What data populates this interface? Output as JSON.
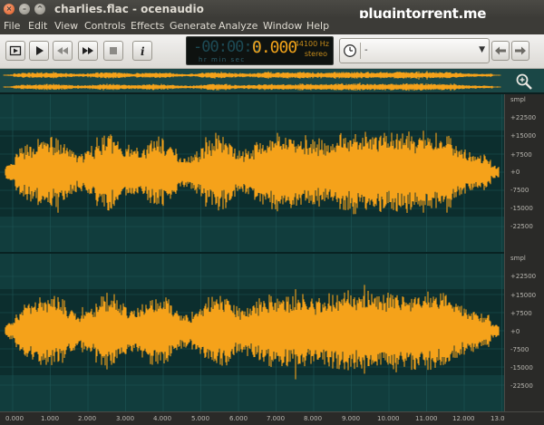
{
  "window": {
    "title": "charlies.flac - ocenaudio",
    "watermark": "plugintorrent.me"
  },
  "menu": [
    "File",
    "Edit",
    "View",
    "Controls",
    "Effects",
    "Generate",
    "Analyze",
    "Window",
    "Help"
  ],
  "display": {
    "time_dim": "-00:00:0",
    "time_value": "0.000",
    "units": "hr  min  sec",
    "sample_rate": "44100 Hz",
    "channels": "stereo"
  },
  "combo": {
    "value": "-"
  },
  "ruler": {
    "unit": "smpl",
    "ticks": [
      "+22500",
      "+15000",
      "+7500",
      "+0",
      "-7500",
      "-15000",
      "-22500"
    ]
  },
  "timeline": [
    "0.000",
    "1.000",
    "2.000",
    "3.000",
    "4.000",
    "5.000",
    "6.000",
    "7.000",
    "8.000",
    "9.000",
    "10.000",
    "11.000",
    "12.000",
    "13.0"
  ],
  "colors": {
    "wave": "#f5a21b",
    "background": "#0f3a3a",
    "accent": "#f0a21a"
  },
  "icons": {
    "play_selection": "play-selection-icon",
    "play": "play-icon",
    "rewind": "rewind-icon",
    "fast_forward": "fast-forward-icon",
    "stop": "stop-icon",
    "info": "info-icon",
    "back": "back-arrow-icon",
    "forward": "forward-arrow-icon",
    "zoom": "zoom-icon"
  }
}
